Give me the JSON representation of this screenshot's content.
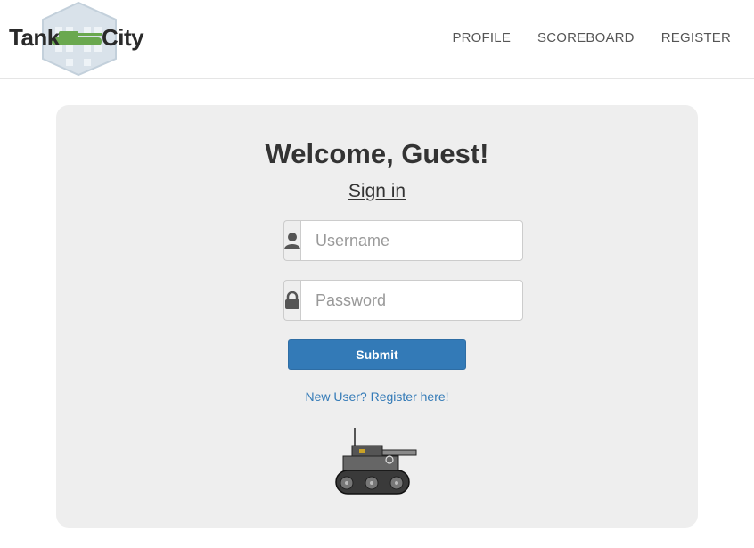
{
  "brand": {
    "left_text": "Tank",
    "right_text": "City",
    "tank_color": "#6aa84f"
  },
  "nav": {
    "items": [
      {
        "label": "PROFILE"
      },
      {
        "label": "SCOREBOARD"
      },
      {
        "label": "REGISTER"
      }
    ]
  },
  "main": {
    "welcome": "Welcome, Guest!",
    "signin": "Sign in",
    "username": {
      "placeholder": "Username",
      "value": "",
      "icon": "user-icon"
    },
    "password": {
      "placeholder": "Password",
      "value": "",
      "icon": "lock-icon"
    },
    "submit_label": "Submit",
    "register_link": "New User? Register here!"
  },
  "colors": {
    "primary": "#337ab7",
    "panel": "#eeeeee",
    "text": "#333333"
  }
}
